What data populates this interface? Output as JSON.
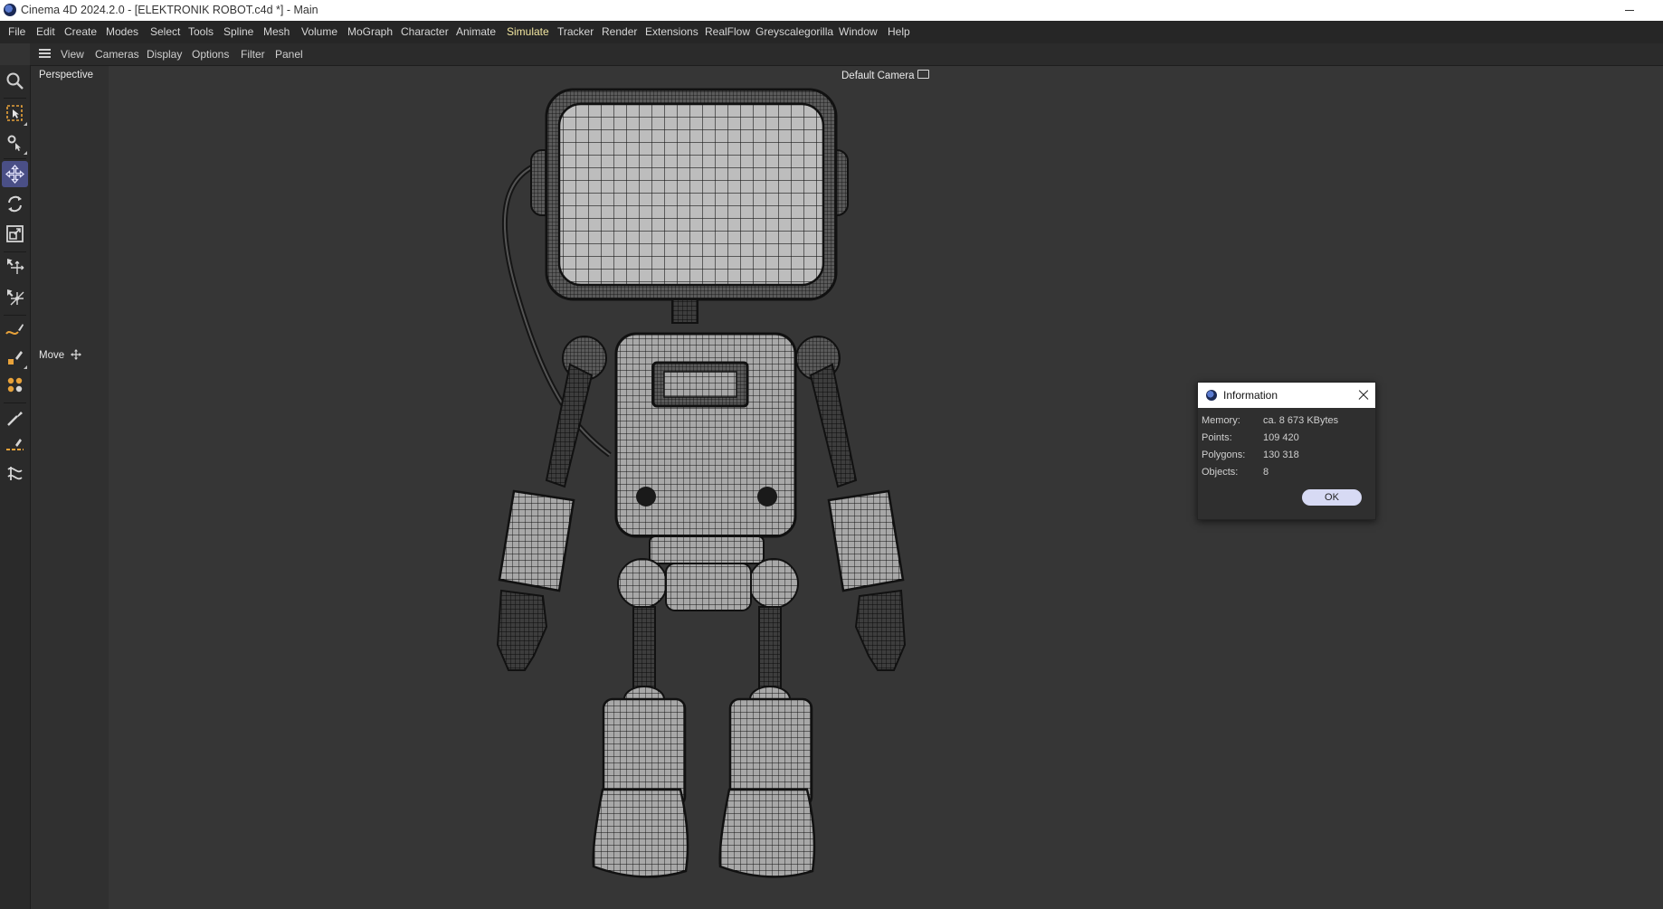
{
  "window": {
    "title": "Cinema 4D 2024.2.0 - [ELEKTRONIK ROBOT.c4d *] - Main"
  },
  "menu": [
    "File",
    "Edit",
    "Create",
    "Modes",
    "Select",
    "Tools",
    "Spline",
    "Mesh",
    "Volume",
    "MoGraph",
    "Character",
    "Animate",
    "Simulate",
    "Tracker",
    "Render",
    "Extensions",
    "RealFlow",
    "Greyscalegorilla",
    "Window",
    "Help"
  ],
  "menu_active": "Simulate",
  "viewport_menu": [
    "View",
    "Cameras",
    "Display",
    "Options",
    "Filter",
    "Panel"
  ],
  "viewport": {
    "label": "Perspective",
    "camera": "Default Camera",
    "tool_label": "Move"
  },
  "toolbar_icons": [
    "search-icon",
    "live-selection-icon",
    "tweak-icon",
    "move-icon",
    "rotate-icon",
    "scale-icon",
    "axis-move-icon",
    "axis-scale-icon",
    "spline-pen-icon",
    "spline-sketch-icon",
    "mograph-cloner-icon",
    "paint-brush-icon",
    "spline-bevel-icon",
    "twist-deformer-icon"
  ],
  "dialog": {
    "title": "Information",
    "rows": [
      {
        "label": "Memory:",
        "value": "ca. 8 673 KBytes"
      },
      {
        "label": "Points:",
        "value": "109 420"
      },
      {
        "label": "Polygons:",
        "value": "130 318"
      },
      {
        "label": "Objects:",
        "value": "8"
      }
    ],
    "ok_label": "OK"
  },
  "colors": {
    "viewport_bg": "#363636",
    "active_tool": "#4a4f86",
    "active_menu": "#f2e6a0",
    "ok_button": "#d7daf4"
  }
}
